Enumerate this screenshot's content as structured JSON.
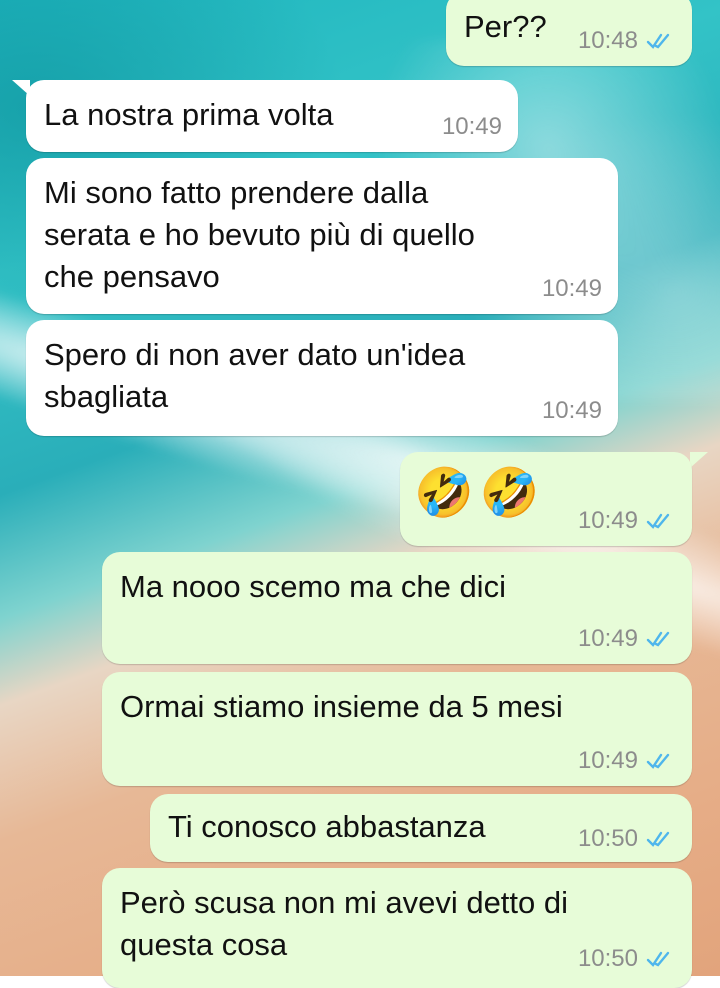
{
  "chat": {
    "messages": [
      {
        "id": "m1",
        "direction": "outgoing",
        "text": "Per??",
        "time": "10:48",
        "status": "read"
      },
      {
        "id": "m2",
        "direction": "incoming",
        "text": "La nostra prima volta",
        "time": "10:49"
      },
      {
        "id": "m3",
        "direction": "incoming",
        "text": "Mi sono fatto prendere dalla\nserata e ho bevuto più di quello\nche pensavo",
        "time": "10:49"
      },
      {
        "id": "m4",
        "direction": "incoming",
        "text": "Spero di non aver dato un'idea\nsbagliata",
        "time": "10:49"
      },
      {
        "id": "m5",
        "direction": "outgoing",
        "text": "🤣🤣",
        "time": "10:49",
        "status": "read"
      },
      {
        "id": "m6",
        "direction": "outgoing",
        "text": "Ma nooo scemo ma che dici",
        "time": "10:49",
        "status": "read"
      },
      {
        "id": "m7",
        "direction": "outgoing",
        "text": "Ormai stiamo insieme da 5 mesi",
        "time": "10:49",
        "status": "read"
      },
      {
        "id": "m8",
        "direction": "outgoing",
        "text": "Ti conosco abbastanza",
        "time": "10:50",
        "status": "read"
      },
      {
        "id": "m9",
        "direction": "outgoing",
        "text": "Però scusa non mi avevi detto di\nquesta cosa",
        "time": "10:50",
        "status": "read"
      }
    ]
  },
  "colors": {
    "incoming_bubble": "#ffffff",
    "outgoing_bubble": "#e7fcd8",
    "read_ticks": "#4fb6ec",
    "timestamp": "#8c8c8c"
  },
  "icons": {
    "read_receipt": "double-check-icon",
    "emoji": "rolling-on-floor-laughing-emoji"
  }
}
